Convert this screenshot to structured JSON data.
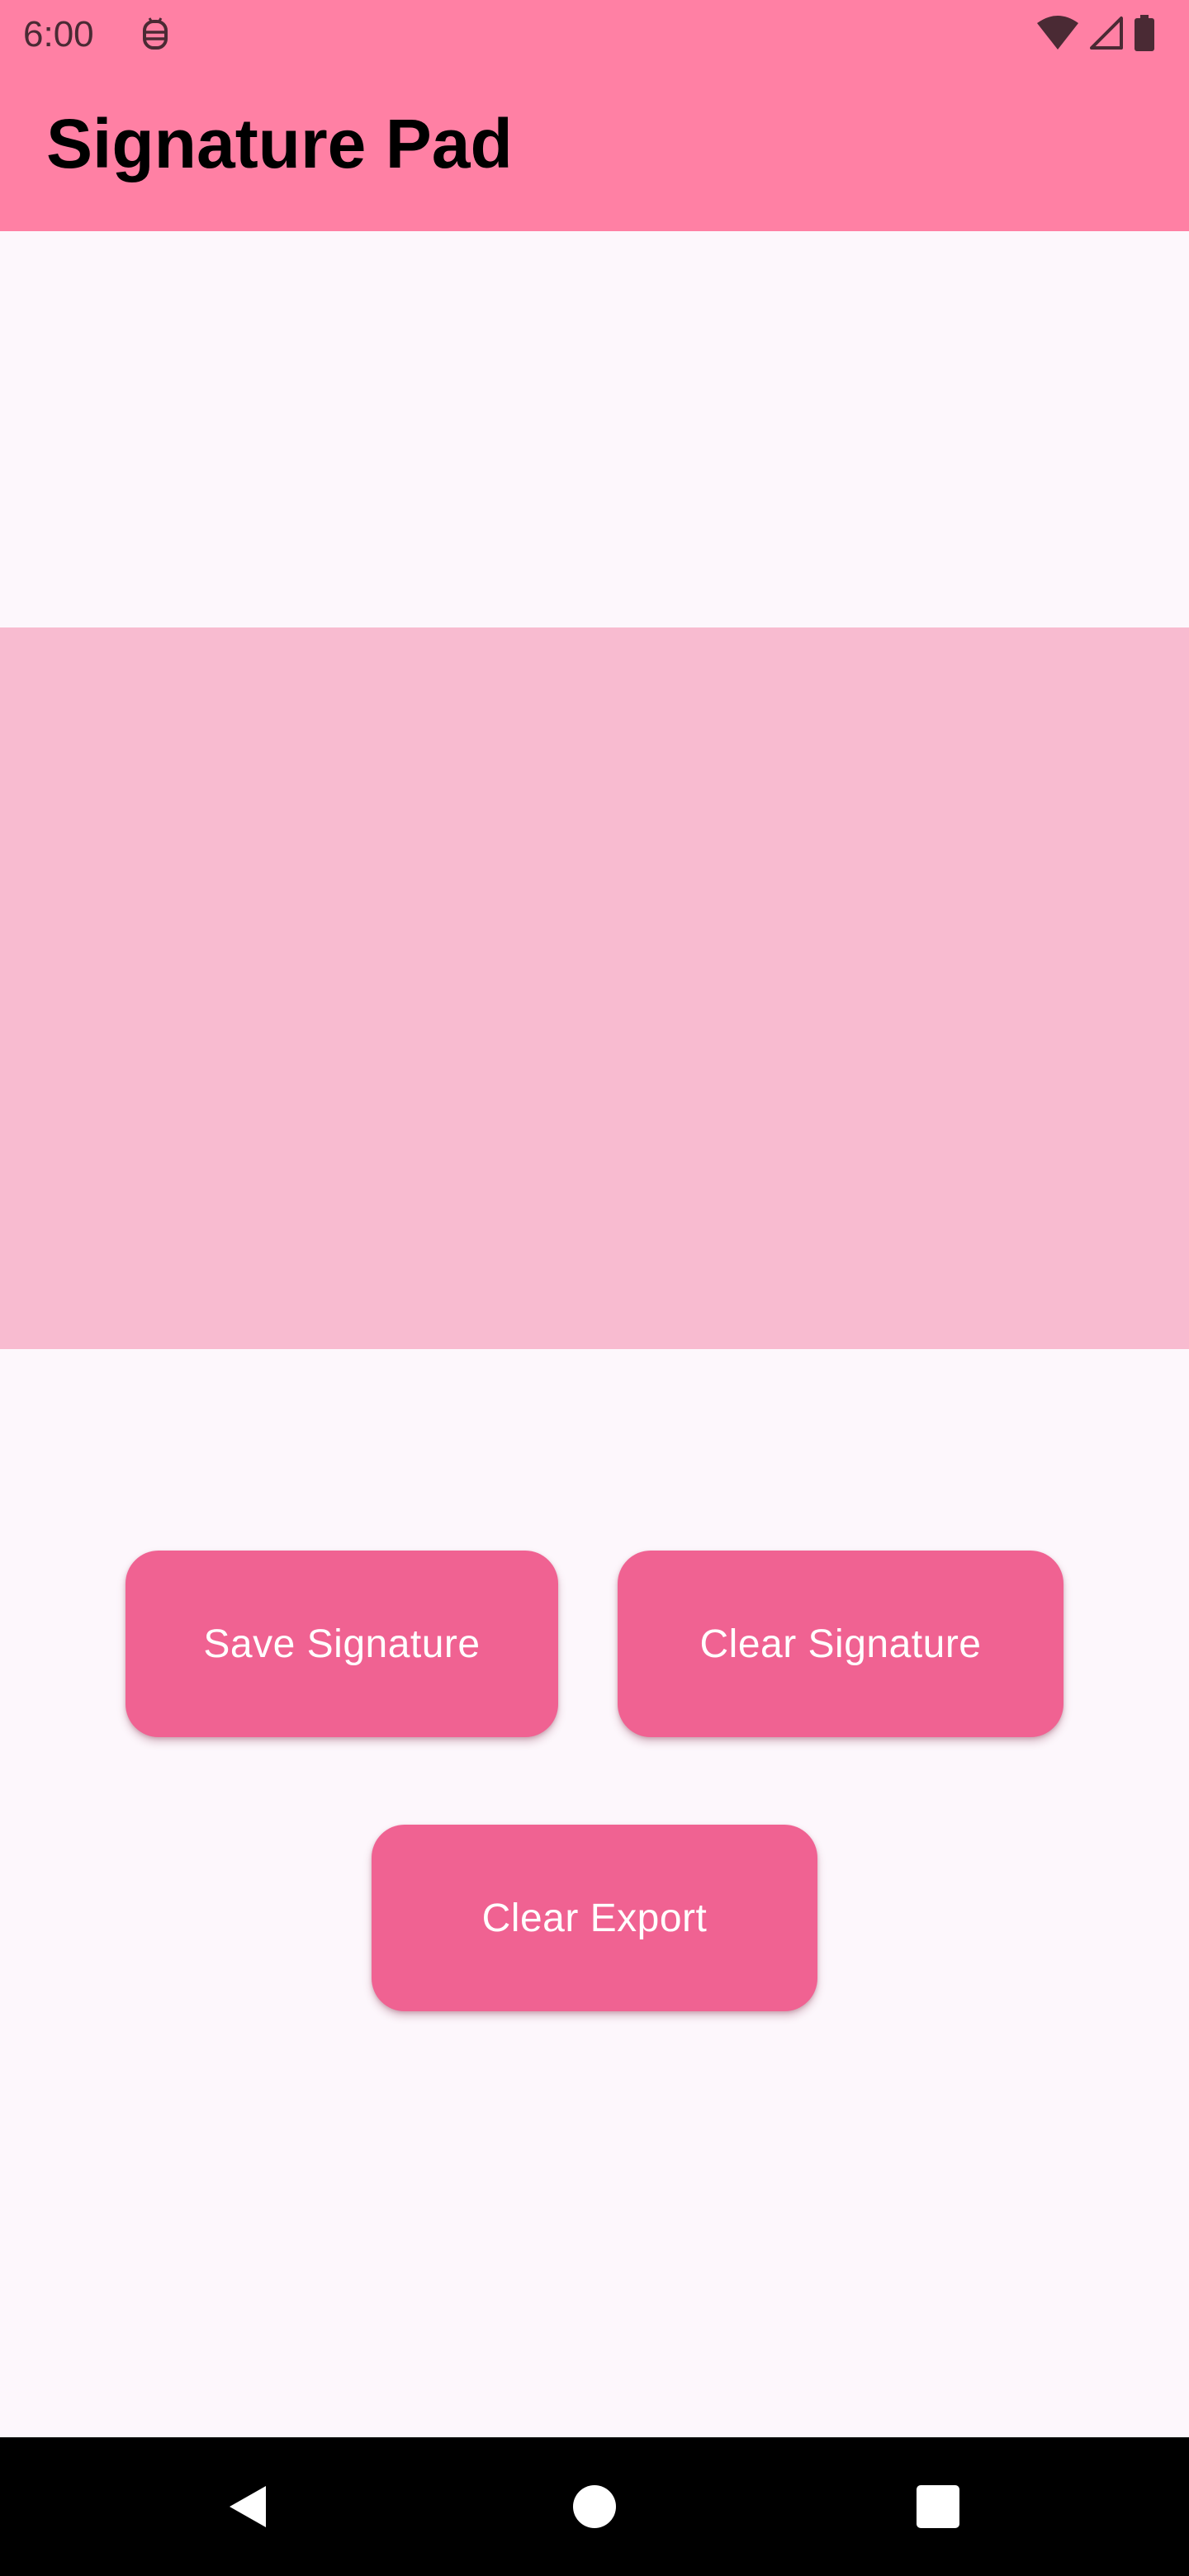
{
  "status_bar": {
    "time": "6:00",
    "icons": [
      "app-notification-icon",
      "wifi-icon",
      "cellular-signal-icon",
      "battery-icon"
    ],
    "background_color": "#FF80A4"
  },
  "app_bar": {
    "title": "Signature Pad",
    "background_color": "#FF80A4"
  },
  "signature_pad": {
    "background_color": "#F8BBD0"
  },
  "buttons": {
    "save_signature": "Save Signature",
    "clear_signature": "Clear Signature",
    "clear_export": "Clear Export",
    "background_color": "#F06292",
    "text_color": "#FFFFFF"
  },
  "nav_bar": {
    "icons": [
      "back-icon",
      "home-icon",
      "recents-icon"
    ]
  },
  "colors": {
    "page_background": "#FDF7FC"
  }
}
